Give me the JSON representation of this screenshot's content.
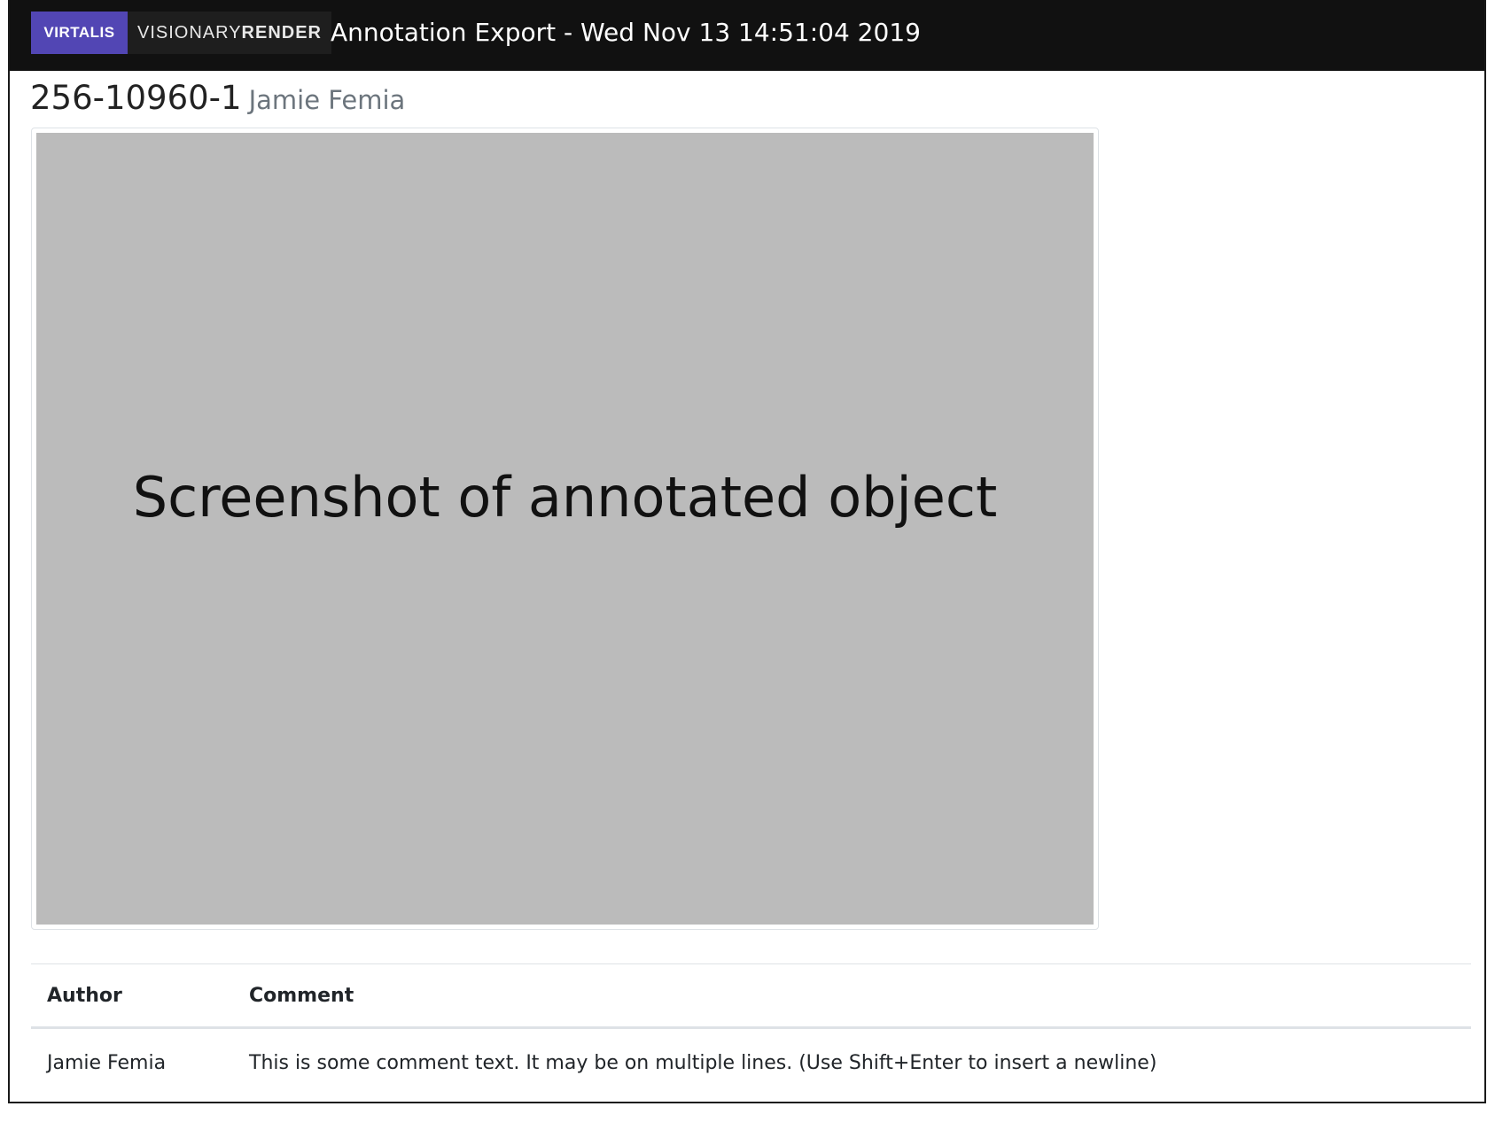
{
  "header": {
    "logo_left": "VIRTALIS",
    "logo_right_light": "VISIONARY",
    "logo_right_bold": "RENDER",
    "title": "Annotation Export - Wed Nov 13 14:51:04 2019"
  },
  "annotation": {
    "id": "256-10960-1",
    "author": "Jamie Femia",
    "screenshot_placeholder": "Screenshot of annotated object"
  },
  "comments": {
    "columns": {
      "author": "Author",
      "comment": "Comment"
    },
    "rows": [
      {
        "author": "Jamie Femia",
        "comment": "This is some comment text. It may be on multiple lines. (Use Shift+Enter to insert a newline)"
      }
    ]
  },
  "colors": {
    "topbar": "#111111",
    "virtalis_brand": "#5246b4",
    "placeholder_gray": "#bbbbbb",
    "muted_text": "#6c757d"
  }
}
